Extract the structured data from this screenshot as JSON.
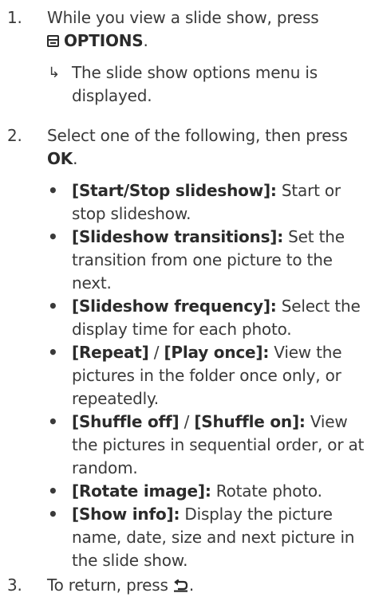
{
  "steps": [
    {
      "number": "1.",
      "text_before": "While you view a slide show, press",
      "button_label": "OPTIONS",
      "text_after": ".",
      "result": "The slide show options menu is displayed."
    },
    {
      "number": "2.",
      "text_before": "Select one of the following, then press ",
      "button_label": "OK",
      "text_after": ".",
      "options": [
        {
          "label": "[Start/Stop slideshow]:",
          "label2": "",
          "sep": "",
          "desc": " Start or stop slideshow."
        },
        {
          "label": "[Slideshow transitions]:",
          "label2": "",
          "sep": "",
          "desc": " Set the transition from one picture to the next."
        },
        {
          "label": "[Slideshow frequency]:",
          "label2": "",
          "sep": "",
          "desc": " Select the display time for each photo."
        },
        {
          "label": "[Repeat]",
          "sep": " / ",
          "label2": "[Play once]:",
          "desc": " View the pictures in the folder once only, or repeatedly."
        },
        {
          "label": "[Shuffle off]",
          "sep": " / ",
          "label2": "[Shuffle on]:",
          "desc": " View the pictures in sequential order, or at random."
        },
        {
          "label": "[Rotate image]:",
          "label2": "",
          "sep": "",
          "desc": " Rotate photo."
        },
        {
          "label": "[Show info]:",
          "label2": "",
          "sep": "",
          "desc": " Display the picture name, date, size and next picture in the slide show."
        }
      ]
    },
    {
      "number": "3.",
      "text_before": "To return, press ",
      "text_after": "."
    }
  ],
  "icons": {
    "options": "options-icon",
    "result_arrow": "result-arrow-icon",
    "bullet": "bullet-icon",
    "back": "back-icon"
  },
  "symbols": {
    "arrow": "↳",
    "bullet": "•"
  }
}
